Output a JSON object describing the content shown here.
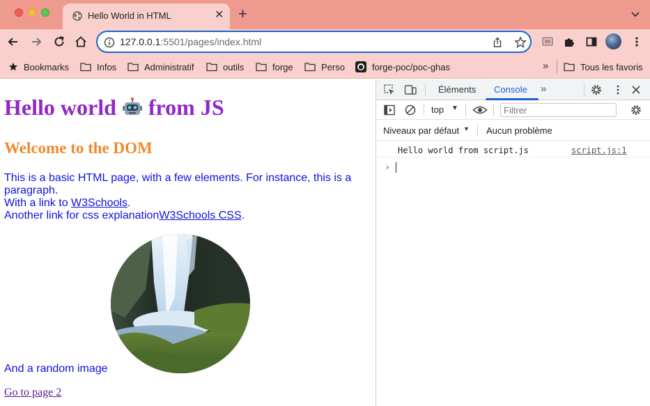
{
  "browser": {
    "tab": {
      "title": "Hello World in HTML",
      "close_glyph": "✕"
    },
    "new_tab_glyph": "+",
    "omnibox": {
      "url_host": "127.0.0.1",
      "url_rest": ":5501/pages/index.html"
    },
    "bookmarks": [
      {
        "label": "Bookmarks",
        "icon": "star-icon"
      },
      {
        "label": "Infos",
        "icon": "folder-icon"
      },
      {
        "label": "Administratif",
        "icon": "folder-icon"
      },
      {
        "label": "outils",
        "icon": "folder-icon"
      },
      {
        "label": "forge",
        "icon": "folder-icon"
      },
      {
        "label": "Perso",
        "icon": "folder-icon"
      },
      {
        "label": "forge-poc/poc-ghas",
        "icon": "github-icon"
      }
    ],
    "bookmarks_more_glyph": "»",
    "all_bookmarks": "Tous les favoris"
  },
  "page": {
    "heading_before": "Hello world",
    "heading_after": "from JS",
    "subheading": "Welcome to the DOM",
    "paragraph": "This is a basic HTML page, with a few elements. For instance, this is a paragraph.",
    "link_line_prefix": "With a link to",
    "link_w3": "W3Schools",
    "link_line_suffix": ".",
    "css_line_prefix": "Another link for css explanation",
    "link_w3_css": "W3Schools CSS",
    "css_line_suffix": ".",
    "image_caption": "And a random image",
    "page2_link": "Go to page 2"
  },
  "devtools": {
    "tabs": [
      {
        "label": "Éléments",
        "active": false
      },
      {
        "label": "Console",
        "active": true
      }
    ],
    "more_tabs_glyph": "»",
    "context": "top",
    "filter_placeholder": "Filtrer",
    "levels": "Niveaux par défaut",
    "issues": "Aucun problème",
    "log": {
      "message": "Hello world from script.js",
      "source": "script.js:1"
    },
    "prompt_glyph": "›"
  },
  "colors": {
    "tabbar": "#ef9a8f",
    "toolbar": "#f9d0cb",
    "accent": "#1a64d2",
    "heading": "#9127c9",
    "subheading": "#f08a2b",
    "body_text": "#1010e0",
    "visited_link": "#5b1a8b"
  }
}
